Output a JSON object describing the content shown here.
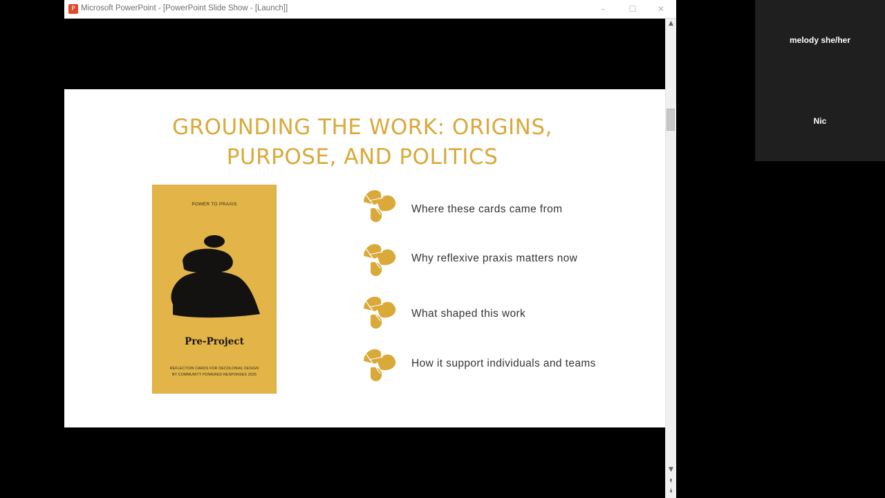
{
  "window": {
    "title": "Microsoft PowerPoint - [PowerPoint Slide Show - [Launch]]",
    "controls": {
      "minimize": "–",
      "maximize": "☐",
      "close": "✕"
    }
  },
  "slide": {
    "title_line1": "GROUNDING THE WORK: ORIGINS,",
    "title_line2": "PURPOSE, AND POLITICS",
    "accent_color": "#d9a93a",
    "book": {
      "top_label": "POWER TO PRAXIS",
      "name": "Pre-Project",
      "subtitle_line1": "REFLECTION CARDS FOR DECOLONIAL DESIGN",
      "subtitle_line2": "BY COMMUNITY POWERED RESPONSES 2025",
      "cover_color": "#e3b548"
    },
    "bullets": [
      {
        "text": "Where these cards came from",
        "icon": "leaf-icon"
      },
      {
        "text": "Why reflexive praxis matters now",
        "icon": "leaf-icon"
      },
      {
        "text": "What shaped this work",
        "icon": "leaf-icon"
      },
      {
        "text": "How it support individuals and teams",
        "icon": "leaf-icon"
      }
    ]
  },
  "scrollbar": {
    "up": "▲",
    "down": "▼",
    "prev": "⯭",
    "next": "⯯"
  },
  "participants": [
    {
      "name": "melody she/her"
    },
    {
      "name": "Nic"
    }
  ]
}
